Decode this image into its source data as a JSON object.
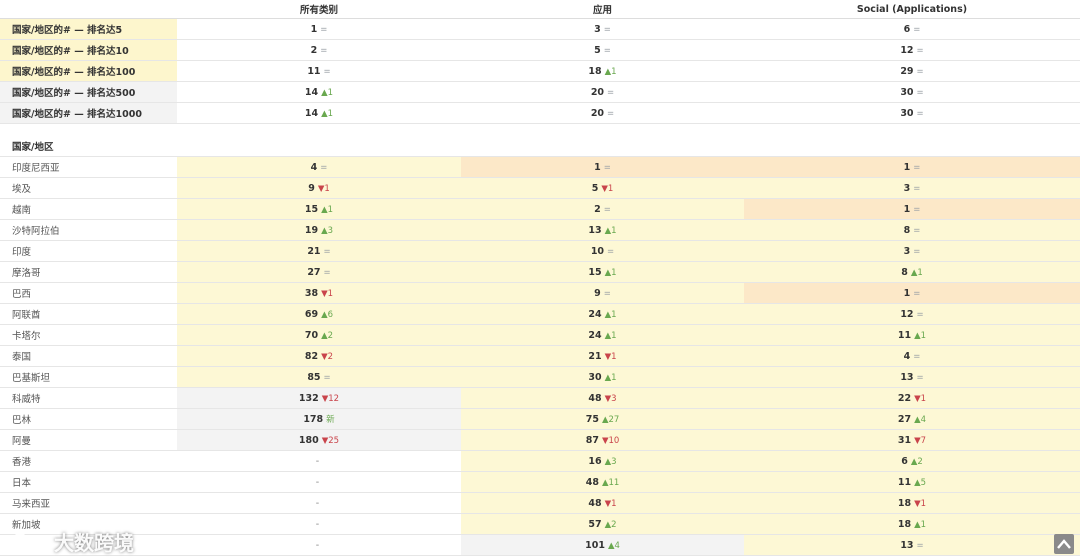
{
  "header": {
    "col1": "所有类别",
    "col2": "应用",
    "col3": "Social (Applications)"
  },
  "summary": [
    {
      "label": "国家/地区的# — 排名达5",
      "c1": {
        "rank": "1",
        "change": "="
      },
      "c2": {
        "rank": "3",
        "change": "="
      },
      "c3": {
        "rank": "6",
        "change": "="
      }
    },
    {
      "label": "国家/地区的# — 排名达10",
      "c1": {
        "rank": "2",
        "change": "="
      },
      "c2": {
        "rank": "5",
        "change": "="
      },
      "c3": {
        "rank": "12",
        "change": "="
      }
    },
    {
      "label": "国家/地区的# — 排名达100",
      "c1": {
        "rank": "11",
        "change": "="
      },
      "c2": {
        "rank": "18",
        "change": "▲1"
      },
      "c3": {
        "rank": "29",
        "change": "="
      }
    },
    {
      "label": "国家/地区的# — 排名达500",
      "c1": {
        "rank": "14",
        "change": "▲1"
      },
      "c2": {
        "rank": "20",
        "change": "="
      },
      "c3": {
        "rank": "30",
        "change": "="
      }
    },
    {
      "label": "国家/地区的# — 排名达1000",
      "c1": {
        "rank": "14",
        "change": "▲1"
      },
      "c2": {
        "rank": "20",
        "change": "="
      },
      "c3": {
        "rank": "30",
        "change": "="
      }
    }
  ],
  "section_title": "国家/地区",
  "countries": [
    {
      "name": "印度尼西亚",
      "c1": {
        "rank": "4",
        "change": "="
      },
      "c2": {
        "rank": "1",
        "change": "="
      },
      "c3": {
        "rank": "1",
        "change": "="
      }
    },
    {
      "name": "埃及",
      "c1": {
        "rank": "9",
        "change": "▼1"
      },
      "c2": {
        "rank": "5",
        "change": "▼1"
      },
      "c3": {
        "rank": "3",
        "change": "="
      }
    },
    {
      "name": "越南",
      "c1": {
        "rank": "15",
        "change": "▲1"
      },
      "c2": {
        "rank": "2",
        "change": "="
      },
      "c3": {
        "rank": "1",
        "change": "="
      }
    },
    {
      "name": "沙特阿拉伯",
      "c1": {
        "rank": "19",
        "change": "▲3"
      },
      "c2": {
        "rank": "13",
        "change": "▲1"
      },
      "c3": {
        "rank": "8",
        "change": "="
      }
    },
    {
      "name": "印度",
      "c1": {
        "rank": "21",
        "change": "="
      },
      "c2": {
        "rank": "10",
        "change": "="
      },
      "c3": {
        "rank": "3",
        "change": "="
      }
    },
    {
      "name": "摩洛哥",
      "c1": {
        "rank": "27",
        "change": "="
      },
      "c2": {
        "rank": "15",
        "change": "▲1"
      },
      "c3": {
        "rank": "8",
        "change": "▲1"
      }
    },
    {
      "name": "巴西",
      "c1": {
        "rank": "38",
        "change": "▼1"
      },
      "c2": {
        "rank": "9",
        "change": "="
      },
      "c3": {
        "rank": "1",
        "change": "="
      }
    },
    {
      "name": "阿联酋",
      "c1": {
        "rank": "69",
        "change": "▲6"
      },
      "c2": {
        "rank": "24",
        "change": "▲1"
      },
      "c3": {
        "rank": "12",
        "change": "="
      }
    },
    {
      "name": "卡塔尔",
      "c1": {
        "rank": "70",
        "change": "▲2"
      },
      "c2": {
        "rank": "24",
        "change": "▲1"
      },
      "c3": {
        "rank": "11",
        "change": "▲1"
      }
    },
    {
      "name": "泰国",
      "c1": {
        "rank": "82",
        "change": "▼2"
      },
      "c2": {
        "rank": "21",
        "change": "▼1"
      },
      "c3": {
        "rank": "4",
        "change": "="
      }
    },
    {
      "name": "巴基斯坦",
      "c1": {
        "rank": "85",
        "change": "="
      },
      "c2": {
        "rank": "30",
        "change": "▲1"
      },
      "c3": {
        "rank": "13",
        "change": "="
      }
    },
    {
      "name": "科威特",
      "c1": {
        "rank": "132",
        "change": "▼12"
      },
      "c2": {
        "rank": "48",
        "change": "▼3"
      },
      "c3": {
        "rank": "22",
        "change": "▼1"
      }
    },
    {
      "name": "巴林",
      "c1": {
        "rank": "178",
        "change": "新"
      },
      "c2": {
        "rank": "75",
        "change": "▲27"
      },
      "c3": {
        "rank": "27",
        "change": "▲4"
      }
    },
    {
      "name": "阿曼",
      "c1": {
        "rank": "180",
        "change": "▼25"
      },
      "c2": {
        "rank": "87",
        "change": "▼10"
      },
      "c3": {
        "rank": "31",
        "change": "▼7"
      }
    },
    {
      "name": "香港",
      "c1": {
        "rank": "-",
        "change": ""
      },
      "c2": {
        "rank": "16",
        "change": "▲3"
      },
      "c3": {
        "rank": "6",
        "change": "▲2"
      }
    },
    {
      "name": "日本",
      "c1": {
        "rank": "-",
        "change": ""
      },
      "c2": {
        "rank": "48",
        "change": "▲11"
      },
      "c3": {
        "rank": "11",
        "change": "▲5"
      }
    },
    {
      "name": "马来西亚",
      "c1": {
        "rank": "-",
        "change": ""
      },
      "c2": {
        "rank": "48",
        "change": "▼1"
      },
      "c3": {
        "rank": "18",
        "change": "▼1"
      }
    },
    {
      "name": "新加坡",
      "c1": {
        "rank": "-",
        "change": ""
      },
      "c2": {
        "rank": "57",
        "change": "▲2"
      },
      "c3": {
        "rank": "18",
        "change": "▲1"
      }
    },
    {
      "name": "",
      "c1": {
        "rank": "-",
        "change": ""
      },
      "c2": {
        "rank": "101",
        "change": "▲4"
      },
      "c3": {
        "rank": "13",
        "change": "="
      }
    }
  ],
  "watermark": {
    "text": "大数跨境",
    "icon": "brand-logo-icon"
  },
  "scroll_top": {
    "icon": "arrow-up-icon"
  },
  "colors": {
    "up": "#69a84f",
    "down": "#c9444b",
    "neutral": "#9aa0a6",
    "light_yellow": "#fdf8d5",
    "light_orange": "#fce8c8",
    "light_gray": "#f3f3f3"
  }
}
